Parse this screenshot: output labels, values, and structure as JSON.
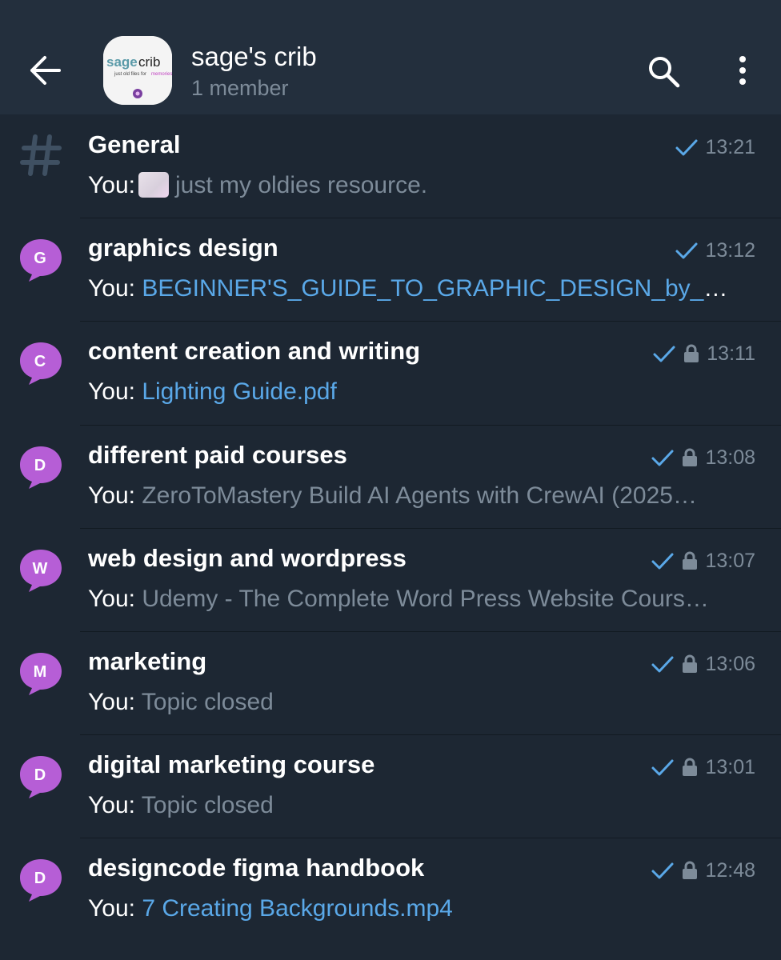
{
  "header": {
    "title": "sage's crib",
    "subtitle": "1 member",
    "avatar_text": "sage crib",
    "avatar_tagline": "just old files for memories",
    "back_icon": "arrow-left-icon",
    "search_icon": "search-icon",
    "menu_icon": "more-vertical-icon"
  },
  "colors": {
    "background": "#1d2733",
    "header": "#232f3d",
    "link": "#5aa8e8",
    "muted": "#7d8b99",
    "avatar_purple": "#b65ed6"
  },
  "topics": [
    {
      "letter": "#",
      "title": "General",
      "sender": "You:",
      "preview": "just my oldies resource.",
      "preview_type": "text",
      "has_thumbnail": true,
      "locked": false,
      "time": "13:21"
    },
    {
      "letter": "G",
      "title": "graphics design",
      "sender": "You:",
      "preview": "BEGINNER'S_GUIDE_TO_GRAPHIC_DESIGN_by_Pr…",
      "preview_type": "file",
      "locked": false,
      "time": "13:12"
    },
    {
      "letter": "C",
      "title": "content creation and writing",
      "sender": "You:",
      "preview": "Lighting Guide.pdf",
      "preview_type": "file",
      "locked": true,
      "time": "13:11"
    },
    {
      "letter": "D",
      "title": "different paid courses",
      "sender": "You:",
      "preview": "ZeroToMastery Build AI Agents with CrewAI (2025…",
      "preview_type": "text",
      "locked": true,
      "time": "13:08"
    },
    {
      "letter": "W",
      "title": "web design and wordpress",
      "sender": "You:",
      "preview": "Udemy - The Complete Word Press Website Cours…",
      "preview_type": "text",
      "locked": true,
      "time": "13:07"
    },
    {
      "letter": "M",
      "title": "marketing",
      "sender": "You:",
      "preview": "Topic closed",
      "preview_type": "text",
      "locked": true,
      "time": "13:06"
    },
    {
      "letter": "D",
      "title": "digital marketing course",
      "sender": "You:",
      "preview": "Topic closed",
      "preview_type": "text",
      "locked": true,
      "time": "13:01"
    },
    {
      "letter": "D",
      "title": "designcode figma handbook",
      "sender": "You:",
      "preview": "7 Creating Backgrounds.mp4",
      "preview_type": "file",
      "locked": true,
      "time": "12:48"
    }
  ]
}
